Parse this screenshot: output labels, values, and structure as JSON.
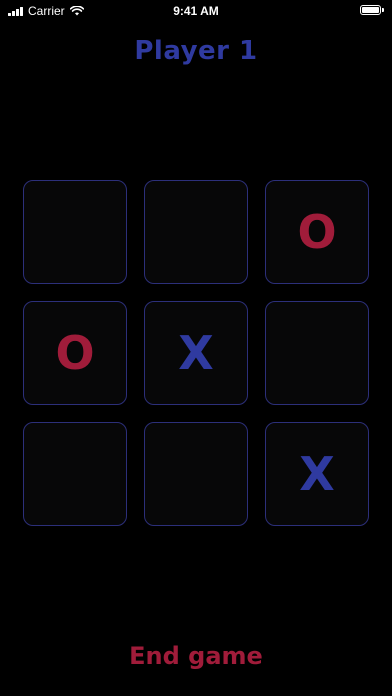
{
  "colors": {
    "player1": "#2f3aa0",
    "player2": "#a01c3a",
    "cell_border": "#2c2f7a",
    "background": "#000000"
  },
  "status_bar": {
    "carrier": "Carrier",
    "time": "9:41 AM",
    "icons": [
      "signal-icon",
      "wifi-icon",
      "battery-icon"
    ]
  },
  "title": "Player 1",
  "board": [
    {
      "mark": ""
    },
    {
      "mark": ""
    },
    {
      "mark": "O"
    },
    {
      "mark": "O"
    },
    {
      "mark": "X"
    },
    {
      "mark": ""
    },
    {
      "mark": ""
    },
    {
      "mark": ""
    },
    {
      "mark": "X"
    }
  ],
  "end_button_label": "End game"
}
